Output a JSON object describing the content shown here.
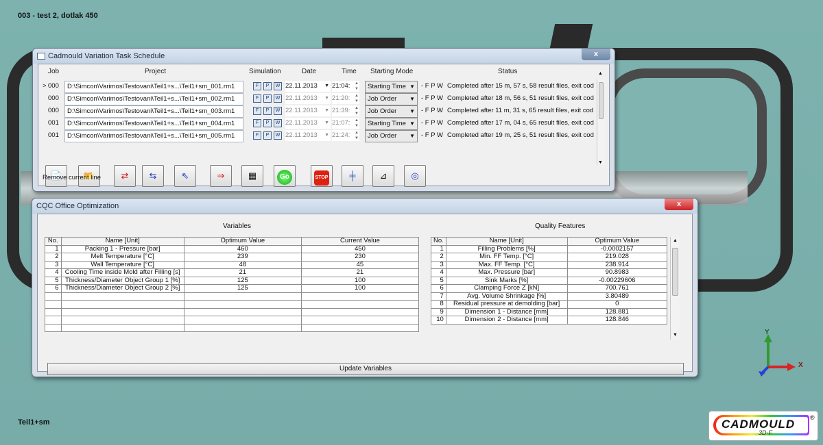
{
  "viewport": {
    "title": "003 - test 2, dotlak 450",
    "model_name": "Teil1+sm",
    "axis_y": "Y",
    "axis_x": "X",
    "logo_text": "CADMOULD",
    "logo_sub": "3D-F",
    "logo_reg": "®"
  },
  "schedule": {
    "title": "Cadmould Variation Task Schedule",
    "close": "x",
    "columns": [
      "Job",
      "Project",
      "Simulation",
      "Date",
      "Time",
      "Starting Mode",
      "Status"
    ],
    "rows": [
      {
        "marker": ">",
        "job": "000",
        "project": "D:\\Simcon\\Varimos\\Testovani\\Teil1+s...\\Teil1+sm_001.rm1",
        "sim": [
          "F",
          "P",
          "W"
        ],
        "date": "22.11.2013",
        "time": "21:04:",
        "mode": "Starting Time",
        "flags": "- F P W",
        "status": "Completed after 15 m, 57 s, 58 result files, exit cod"
      },
      {
        "marker": "",
        "job": "000",
        "project": "D:\\Simcon\\Varimos\\Testovani\\Teil1+s...\\Teil1+sm_002.rm1",
        "sim": [
          "F",
          "P",
          "W"
        ],
        "date": "22.11.2013",
        "time": "21:20:",
        "mode": "Job Order",
        "flags": "- F P W",
        "status": "Completed after 18 m, 56 s, 51 result files, exit cod"
      },
      {
        "marker": "",
        "job": "000",
        "project": "D:\\Simcon\\Varimos\\Testovani\\Teil1+s...\\Teil1+sm_003.rm1",
        "sim": [
          "F",
          "P",
          "W"
        ],
        "date": "22.11.2013",
        "time": "21:39:",
        "mode": "Job Order",
        "flags": "- F P W",
        "status": "Completed after 11 m, 31 s, 65 result files, exit cod"
      },
      {
        "marker": "",
        "job": "001",
        "project": "D:\\Simcon\\Varimos\\Testovani\\Teil1+s...\\Teil1+sm_004.rm1",
        "sim": [
          "F",
          "P",
          "W"
        ],
        "date": "22.11.2013",
        "time": "21:07:",
        "mode": "Starting Time",
        "flags": "- F P W",
        "status": "Completed after 17 m, 04 s, 65 result files, exit cod"
      },
      {
        "marker": "",
        "job": "001",
        "project": "D:\\Simcon\\Varimos\\Testovani\\Teil1+s...\\Teil1+sm_005.rm1",
        "sim": [
          "F",
          "P",
          "W"
        ],
        "date": "22.11.2013",
        "time": "21:24:",
        "mode": "Job Order",
        "flags": "- F P W",
        "status": "Completed after 19 m, 25 s, 51 result files, exit cod"
      }
    ],
    "toolbar": {
      "go_label": "Go",
      "stop_label": "STOP"
    },
    "status_hint": "Remove current line"
  },
  "optimization": {
    "title": "CQC Office Optimization",
    "close": "x",
    "variables": {
      "heading": "Variables",
      "columns": [
        "No.",
        "Name [Unit]",
        "Optimum Value",
        "Current Value"
      ],
      "rows": [
        {
          "no": "1",
          "name": "Packing 1 - Pressure [bar]",
          "opt": "460",
          "cur": "450"
        },
        {
          "no": "2",
          "name": "Melt Temperature [°C]",
          "opt": "239",
          "cur": "230"
        },
        {
          "no": "3",
          "name": "Wall Temperature [°C]",
          "opt": "48",
          "cur": "45"
        },
        {
          "no": "4",
          "name": "Cooling Time inside Mold after Filling [s]",
          "opt": "21",
          "cur": "21"
        },
        {
          "no": "5",
          "name": "Thickness/Diameter Object Group 1 [%]",
          "opt": "125",
          "cur": "100"
        },
        {
          "no": "6",
          "name": "Thickness/Diameter Object Group 2 [%]",
          "opt": "125",
          "cur": "100"
        }
      ]
    },
    "quality": {
      "heading": "Quality Features",
      "columns": [
        "No.",
        "Name [Unit]",
        "Optimum Value"
      ],
      "rows": [
        {
          "no": "1",
          "name": "Filling Problems [%]",
          "opt": "-0.0002157"
        },
        {
          "no": "2",
          "name": "Min. FF Temp. [°C]",
          "opt": "219.028"
        },
        {
          "no": "3",
          "name": "Max. FF Temp. [°C]",
          "opt": "238.914"
        },
        {
          "no": "4",
          "name": "Max. Pressure [bar]",
          "opt": "90.8983"
        },
        {
          "no": "5",
          "name": "Sink Marks [%]",
          "opt": "-0.00229606"
        },
        {
          "no": "6",
          "name": "Clamping Force Z [kN]",
          "opt": "700.761"
        },
        {
          "no": "7",
          "name": "Avg. Volume Shrinkage [%]",
          "opt": "3.80489"
        },
        {
          "no": "8",
          "name": "Residual pressure at demolding [bar]",
          "opt": "0"
        },
        {
          "no": "9",
          "name": "Dimension 1 - Distance [mm]",
          "opt": "128.881"
        },
        {
          "no": "10",
          "name": "Dimension 2 - Distance [mm]",
          "opt": "128.846"
        }
      ]
    },
    "update_label": "Update Variables"
  }
}
